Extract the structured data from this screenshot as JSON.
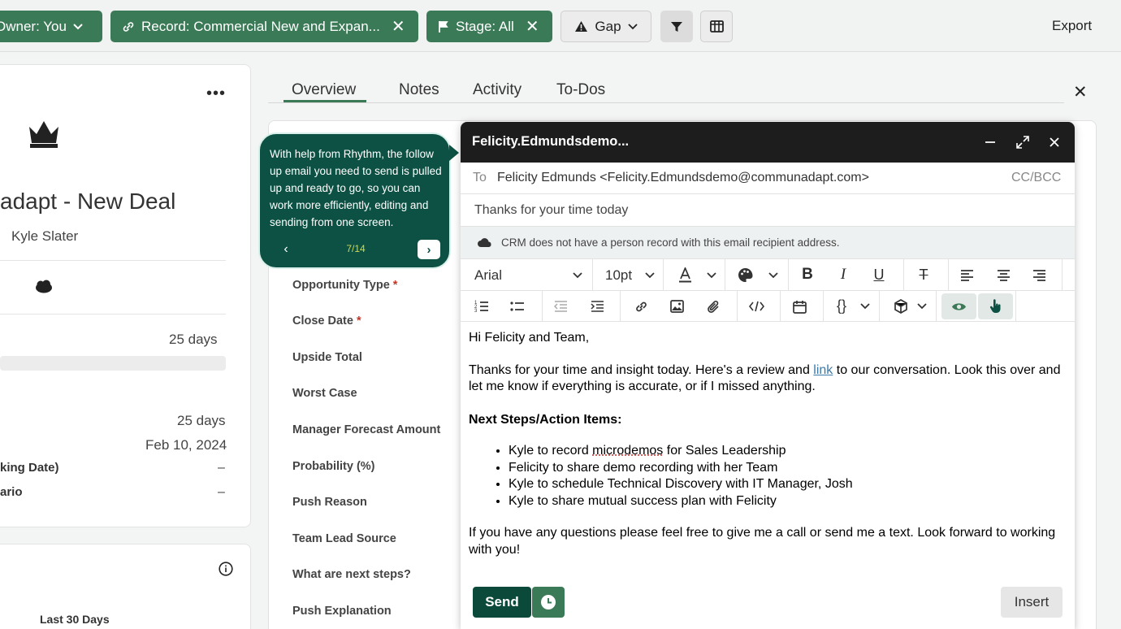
{
  "filters": {
    "owner": "Owner: You",
    "record": "Record: Commercial New and Expan...",
    "stage": "Stage: All",
    "gap": "Gap",
    "export": "Export"
  },
  "left_panel": {
    "deal_title": "adapt - New Deal",
    "owner_name": "Kyle Slater",
    "days_1": "25 days",
    "days_2": "25 days",
    "date": "Feb 10, 2024",
    "label_working_date": "king Date)",
    "label_scenario": "ario",
    "dash_1": "–",
    "dash_2": "–",
    "period": "Last 30 Days"
  },
  "tabs": [
    "Overview",
    "Notes",
    "Activity",
    "To-Dos"
  ],
  "fields": [
    {
      "label": "Opportunity Type",
      "required": "*"
    },
    {
      "label": "Close Date",
      "required": "*"
    },
    {
      "label": "Upside Total",
      "required": ""
    },
    {
      "label": "Worst Case",
      "required": ""
    },
    {
      "label": "Manager Forecast Amount",
      "required": ""
    },
    {
      "label": "Probability (%)",
      "required": ""
    },
    {
      "label": "Push Reason",
      "required": ""
    },
    {
      "label": "Team Lead Source",
      "required": ""
    },
    {
      "label": "What are next steps?",
      "required": ""
    },
    {
      "label": "Push Explanation",
      "required": ""
    }
  ],
  "tooltip": {
    "text": "With help from Rhythm, the follow up email you need to send is pulled up and ready to go, so you can work more efficiently, editing and sending from one screen.",
    "step": "7/14"
  },
  "composer": {
    "title": "Felicity.Edmundsdemo...",
    "to_label": "To",
    "to_value": "Felicity Edmunds <Felicity.Edmundsdemo@communadapt.com>",
    "cc_bcc": "CC/BCC",
    "subject": "Thanks for your time today",
    "warning": "CRM does not have a person record with this email recipient address.",
    "font": "Arial",
    "size": "10pt",
    "greeting": "Hi Felicity and Team,",
    "para1_before": "Thanks for your time and insight today. Here's a review and ",
    "para1_link": "link",
    "para1_after": " to our conversation. Look this over and let me know if everything is accurate, or if I missed anything.",
    "next_steps_heading": "Next Steps/Action Items:",
    "action_items": [
      "Kyle to record microdemos for Sales Leadership",
      "Felicity to share demo recording with her Team",
      "Kyle to schedule Technical Discovery with IT Manager, Josh",
      "Kyle to share mutual success plan with Felicity"
    ],
    "closing": "If you have any questions please feel free to give me a call or send me a text. Look forward to working with you!",
    "send_label": "Send",
    "insert_label": "Insert"
  },
  "colors": {
    "chip_green": "#3b7a57",
    "tooltip_bg": "#0c5143",
    "send_bg": "#0b4a3a"
  }
}
